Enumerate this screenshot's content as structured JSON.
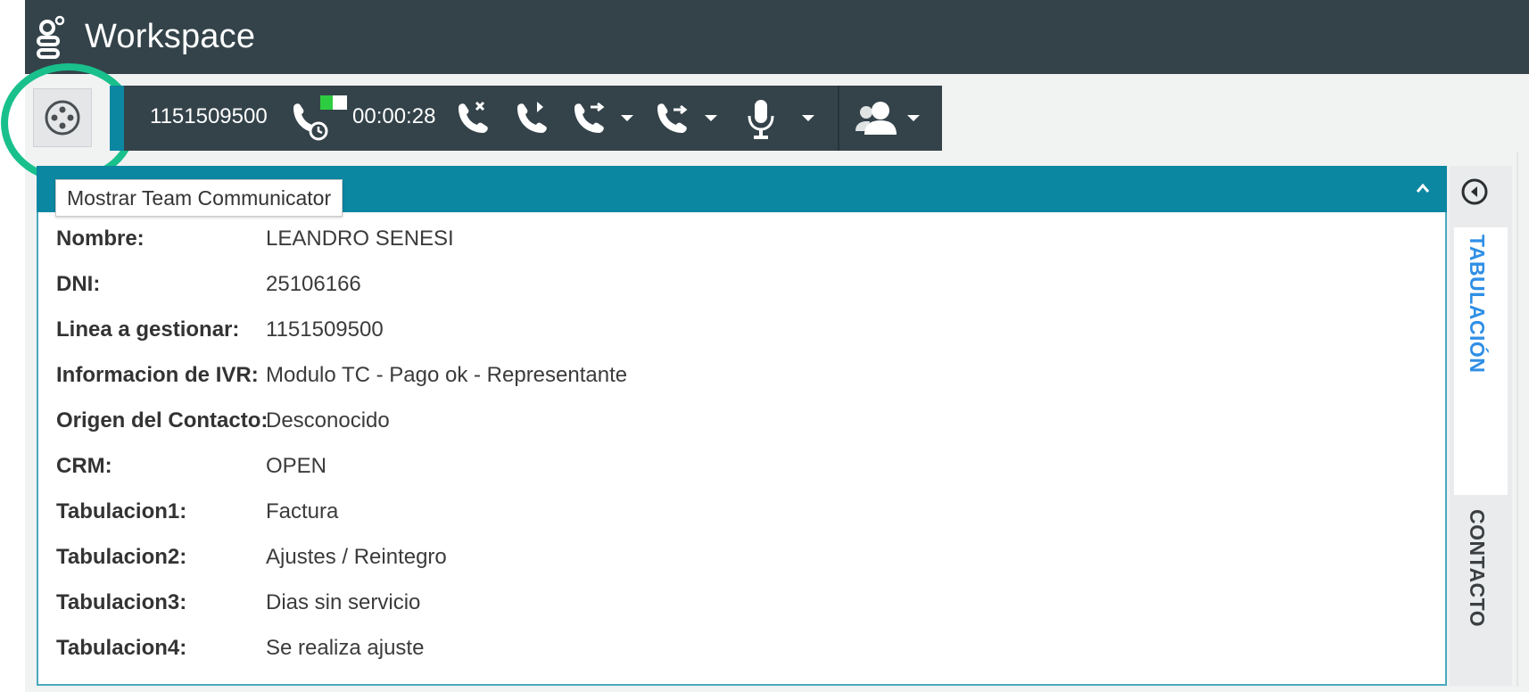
{
  "app": {
    "title": "Workspace"
  },
  "call": {
    "phone_number": "1151509500",
    "timer": "00:00:28"
  },
  "tooltip": {
    "text": "Mostrar Team Communicator"
  },
  "contact_rows": [
    {
      "label": "Nombre:",
      "value": "LEANDRO SENESI"
    },
    {
      "label": "DNI:",
      "value": "25106166"
    },
    {
      "label": "Linea a gestionar:",
      "value": "1151509500"
    },
    {
      "label": "Informacion de IVR:",
      "value": "Modulo TC - Pago ok - Representante"
    },
    {
      "label": "Origen del Contacto:",
      "value": "Desconocido"
    },
    {
      "label": "CRM:",
      "value": "OPEN"
    },
    {
      "label": "Tabulacion1:",
      "value": "Factura"
    },
    {
      "label": "Tabulacion2:",
      "value": "Ajustes / Reintegro"
    },
    {
      "label": "Tabulacion3:",
      "value": "Dias sin servicio"
    },
    {
      "label": "Tabulacion4:",
      "value": "Se realiza ajuste"
    }
  ],
  "side_tabs": [
    {
      "label": "TABULACIÓN",
      "active": true
    },
    {
      "label": "CONTACTO",
      "active": false
    }
  ],
  "colors": {
    "titlebar": "#34434a",
    "accent": "#0c87a1",
    "highlight": "#19c08b",
    "active_tab": "#2f8fe6"
  },
  "icons": [
    "genesys-logo-icon",
    "team-communicator-icon",
    "call-status-icon",
    "end-call-icon",
    "hold-call-icon",
    "transfer-call-icon",
    "conference-call-icon",
    "microphone-icon",
    "agent-status-icon",
    "collapse-icon",
    "side-panel-toggle-icon"
  ]
}
